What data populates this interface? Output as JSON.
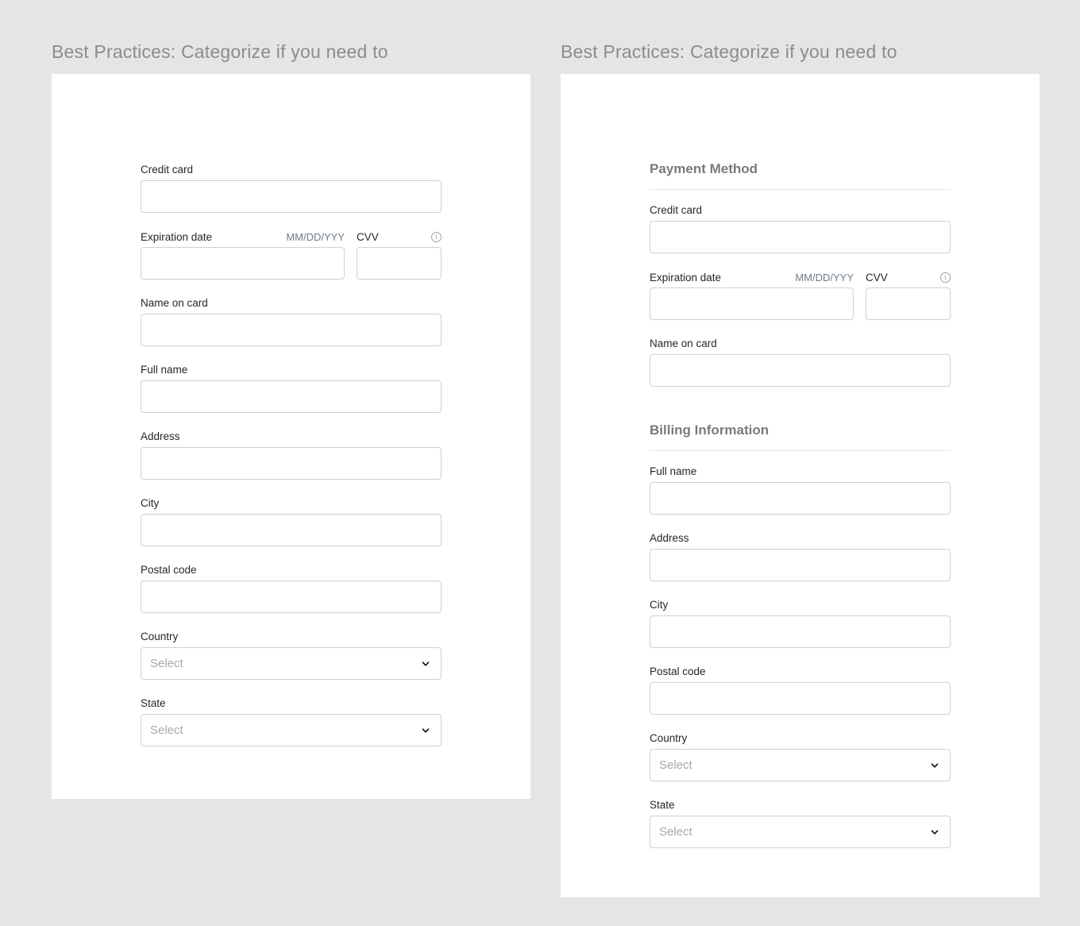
{
  "left": {
    "title": "Best Practices: Categorize if you need to",
    "fields": {
      "credit_card": "Credit card",
      "expiration_date": "Expiration date",
      "expiration_hint": "MM/DD/YYY",
      "cvv": "CVV",
      "name_on_card": "Name on card",
      "full_name": "Full name",
      "address": "Address",
      "city": "City",
      "postal_code": "Postal code",
      "country": "Country",
      "country_value": "Select",
      "state": "State",
      "state_value": "Select"
    }
  },
  "right": {
    "title": "Best Practices: Categorize if you need to",
    "section_payment": "Payment Method",
    "section_billing": "Billing Information",
    "fields": {
      "credit_card": "Credit card",
      "expiration_date": "Expiration date",
      "expiration_hint": "MM/DD/YYY",
      "cvv": "CVV",
      "name_on_card": "Name on card",
      "full_name": "Full name",
      "address": "Address",
      "city": "City",
      "postal_code": "Postal code",
      "country": "Country",
      "country_value": "Select",
      "state": "State",
      "state_value": "Select"
    }
  },
  "icons": {
    "info": "info-icon",
    "dropdown": "chevron-down-icon"
  },
  "colors": {
    "background": "#e5e5e5",
    "card": "#ffffff",
    "title": "#8c8c8c",
    "hint": "#6f7c8c",
    "input_border": "#d0d0d0"
  }
}
